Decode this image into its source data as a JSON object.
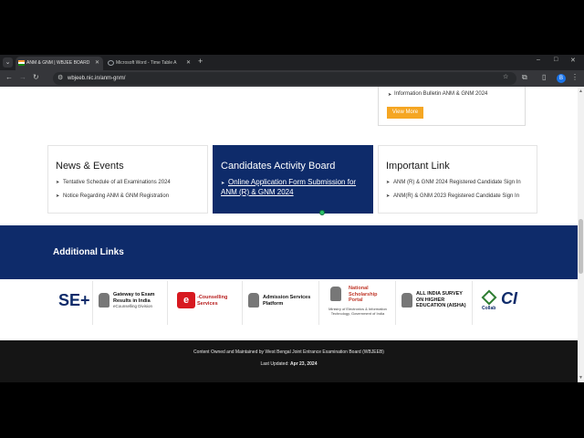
{
  "browser": {
    "tabs": [
      {
        "title": "ANM & GNM | WBJEE BOARD",
        "active": true
      },
      {
        "title": "Microsoft Word - Time Table A",
        "active": false
      }
    ],
    "new_tab_label": "+",
    "url": "wbjeeb.nic.in/anm-gnm/",
    "window_controls": [
      "–",
      "□",
      "✕"
    ],
    "profile_initial": "B"
  },
  "info_box": {
    "item": "Information Bulletin ANM & GNM 2024",
    "button": "View More"
  },
  "news": {
    "title": "News & Events",
    "items": [
      "Tentative Schedule of all Examinations 2024",
      "Notice Regarding ANM & GNM Registration"
    ]
  },
  "activity": {
    "title": "Candidates Activity Board",
    "link": "Online Application Form Submission for ANM (R) & GNM 2024"
  },
  "important": {
    "title": "Important Link",
    "items": [
      "ANM (R) & GNM 2024 Registered Candidate Sign In",
      "ANM(R) & GNM 2023 Registered Candidate Sign In"
    ]
  },
  "additional_links": {
    "title": "Additional Links",
    "logos": [
      {
        "name": "SE+",
        "lines": [
          "SE+"
        ]
      },
      {
        "name": "Gateway to Exam Results in India",
        "lines": [
          "Gateway to Exam",
          "Results in India"
        ],
        "sub": "eCounselling Division"
      },
      {
        "name": "e-Counselling Services",
        "lines": [
          "-Counselling",
          "Services"
        ]
      },
      {
        "name": "Admission Services Platform",
        "lines": [
          "Admission Services",
          "Platform"
        ]
      },
      {
        "name": "National Scholarship Portal",
        "lines": [
          "National",
          "Scholarship",
          "Portal"
        ],
        "sub": "Ministry of Electronics & Information Technology, Government of India"
      },
      {
        "name": "All India Survey on Higher Education (AISHE)",
        "lines": [
          "ALL INDIA SURVEY",
          "ON HIGHER",
          "EDUCATION (AISHA)"
        ]
      },
      {
        "name": "Collab CI",
        "lines": [
          "Collab",
          "CI"
        ]
      }
    ]
  },
  "footer": {
    "owner": "Content Owned and Maintained by West Bengal Joint Entrance Examination Board (WBJEEB)",
    "updated_label": "Last Updated:",
    "updated_date": "Apr 23, 2024"
  },
  "colors": {
    "navy": "#0e2b6a",
    "accent": "#f5a623",
    "footer": "#151515"
  }
}
